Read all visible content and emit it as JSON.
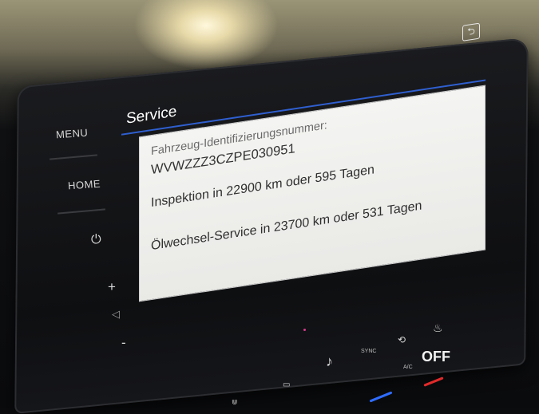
{
  "hard_keys": {
    "menu": "MENU",
    "home": "HOME",
    "power_icon": "power-icon",
    "plus": "+",
    "minus": "-"
  },
  "screen": {
    "title": "Service",
    "back_icon": "back-arrow-icon",
    "lines": {
      "vin_label": "Fahrzeug-Identifizierungsnummer:",
      "vin": "WVWZZZ3CZPE030951",
      "inspection": "Inspektion in 22900 km oder 595 Tagen",
      "oil_service": "Ölwechsel-Service in 23700 km oder 531 Tagen"
    }
  },
  "climate": {
    "sync": "SYNC",
    "ac": "A/C",
    "off": "OFF"
  },
  "colors": {
    "accent_blue": "#2f5fd0",
    "panel_bg": "#f0f0ee"
  }
}
